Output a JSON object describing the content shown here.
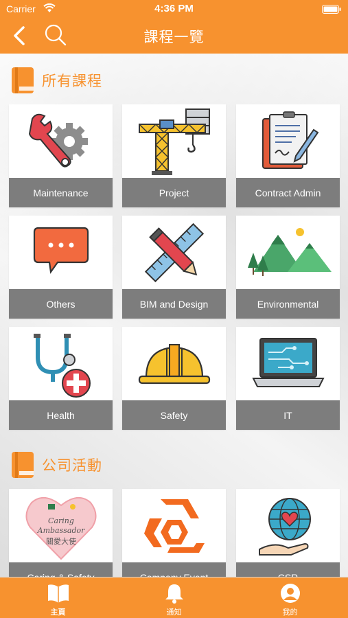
{
  "status_bar": {
    "carrier": "Carrier",
    "time": "4:36 PM"
  },
  "header": {
    "title": "課程一覽"
  },
  "sections": [
    {
      "title": "所有課程",
      "tiles": [
        {
          "label": "Maintenance",
          "icon": "wrench-gear-icon"
        },
        {
          "label": "Project",
          "icon": "crane-icon"
        },
        {
          "label": "Contract Admin",
          "icon": "contract-folder-icon"
        },
        {
          "label": "Others",
          "icon": "chat-bubble-icon"
        },
        {
          "label": "BIM and Design",
          "icon": "pencil-ruler-icon"
        },
        {
          "label": "Environmental",
          "icon": "mountains-trees-icon"
        },
        {
          "label": "Health",
          "icon": "stethoscope-icon"
        },
        {
          "label": "Safety",
          "icon": "hard-hat-icon"
        },
        {
          "label": "IT",
          "icon": "laptop-icon"
        }
      ]
    },
    {
      "title": "公司活動",
      "tiles": [
        {
          "label": "Caring & Safety",
          "icon": "caring-ambassador-heart-icon",
          "art_lines": [
            "Caring",
            "Ambassador",
            "關愛大使"
          ]
        },
        {
          "label": "Company Event",
          "icon": "company-logo-icon"
        },
        {
          "label": "CSR",
          "icon": "globe-hand-icon"
        }
      ]
    }
  ],
  "tabbar": [
    {
      "label": "主頁",
      "icon": "book-icon",
      "active": true
    },
    {
      "label": "通知",
      "icon": "bell-icon",
      "active": false
    },
    {
      "label": "我的",
      "icon": "profile-icon",
      "active": false
    }
  ],
  "colors": {
    "accent": "#f7922f",
    "tile_label_bg": "#7d7d7d"
  }
}
